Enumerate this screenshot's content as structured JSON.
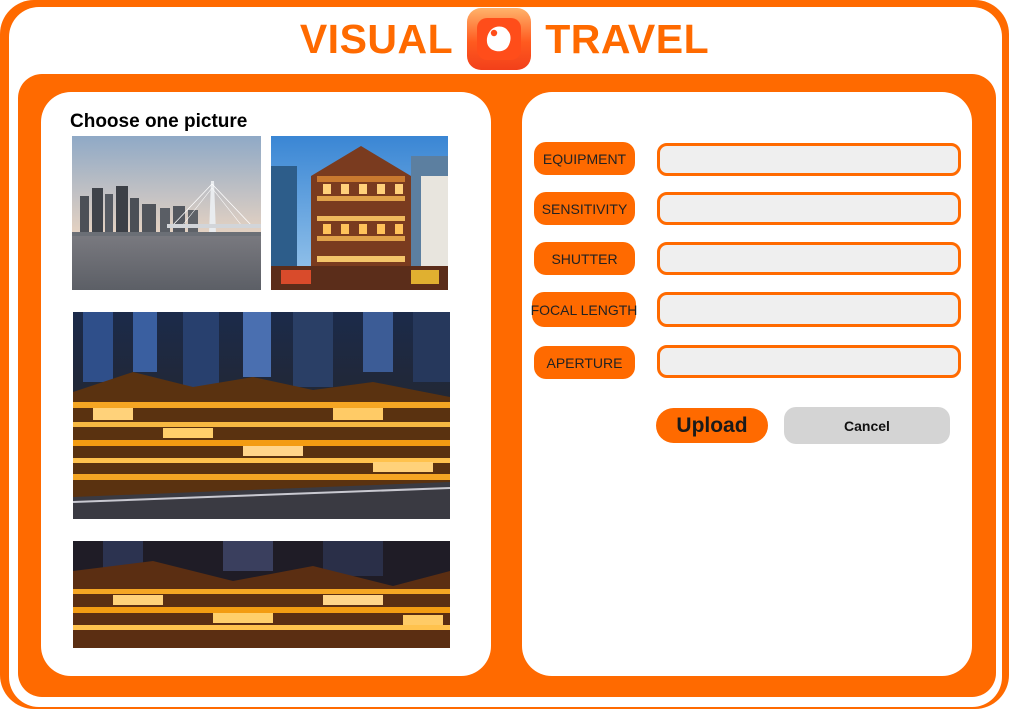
{
  "header": {
    "title_left": "VISUAL",
    "title_right": "TRAVEL",
    "logo_icon": "camera-blob-icon"
  },
  "gallery": {
    "heading": "Choose one picture",
    "photos": [
      {
        "name": "photo-river-bridge",
        "icon": "image-icon"
      },
      {
        "name": "photo-hongyadong-day",
        "icon": "image-icon"
      },
      {
        "name": "photo-hongyadong-night",
        "icon": "image-icon"
      },
      {
        "name": "photo-hongyadong-night-2",
        "icon": "image-icon"
      }
    ]
  },
  "form": {
    "fields": [
      {
        "label": "EQUIPMENT",
        "value": "",
        "placeholder": ""
      },
      {
        "label": "SENSITIVITY",
        "value": "",
        "placeholder": ""
      },
      {
        "label": "SHUTTER",
        "value": "",
        "placeholder": ""
      },
      {
        "label": "FOCAL LENGTH",
        "value": "",
        "placeholder": ""
      },
      {
        "label": "APERTURE",
        "value": "",
        "placeholder": ""
      }
    ],
    "upload_label": "Upload",
    "cancel_label": "Cancel"
  },
  "colors": {
    "accent": "#ff6a00",
    "field_bg": "#efefef",
    "cancel_bg": "#d4d4d4"
  }
}
